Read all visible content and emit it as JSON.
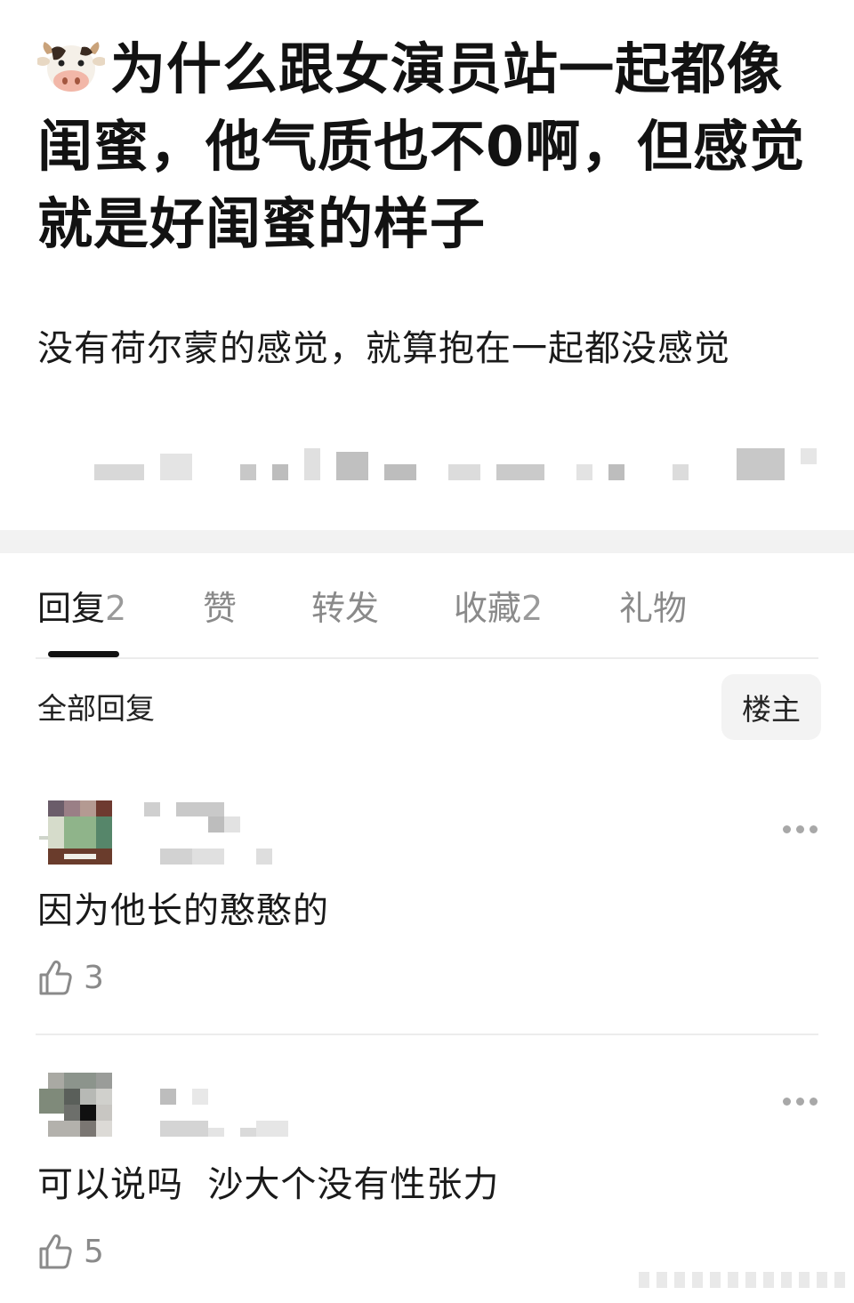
{
  "post": {
    "emoji": "cow-face",
    "title": "为什么跟女演员站一起都像闺蜜，他气质也不0啊，但感觉就是好闺蜜的样子",
    "body": "没有荷尔蒙的感觉，就算抱在一起都没感觉"
  },
  "tabs": [
    {
      "label": "回复",
      "count": "2"
    },
    {
      "label": "赞",
      "count": ""
    },
    {
      "label": "转发",
      "count": ""
    },
    {
      "label": "收藏",
      "count": "2"
    },
    {
      "label": "礼物",
      "count": ""
    }
  ],
  "filter": {
    "label": "全部回复",
    "op_button": "楼主"
  },
  "comments": [
    {
      "text": "因为他长的憨憨的",
      "likes": "3"
    },
    {
      "text": "可以说吗  沙大个没有性张力",
      "likes": "5"
    }
  ],
  "colors": {
    "accent": "#111111",
    "muted": "#8a8a8a",
    "separator": "#f2f2f2"
  }
}
